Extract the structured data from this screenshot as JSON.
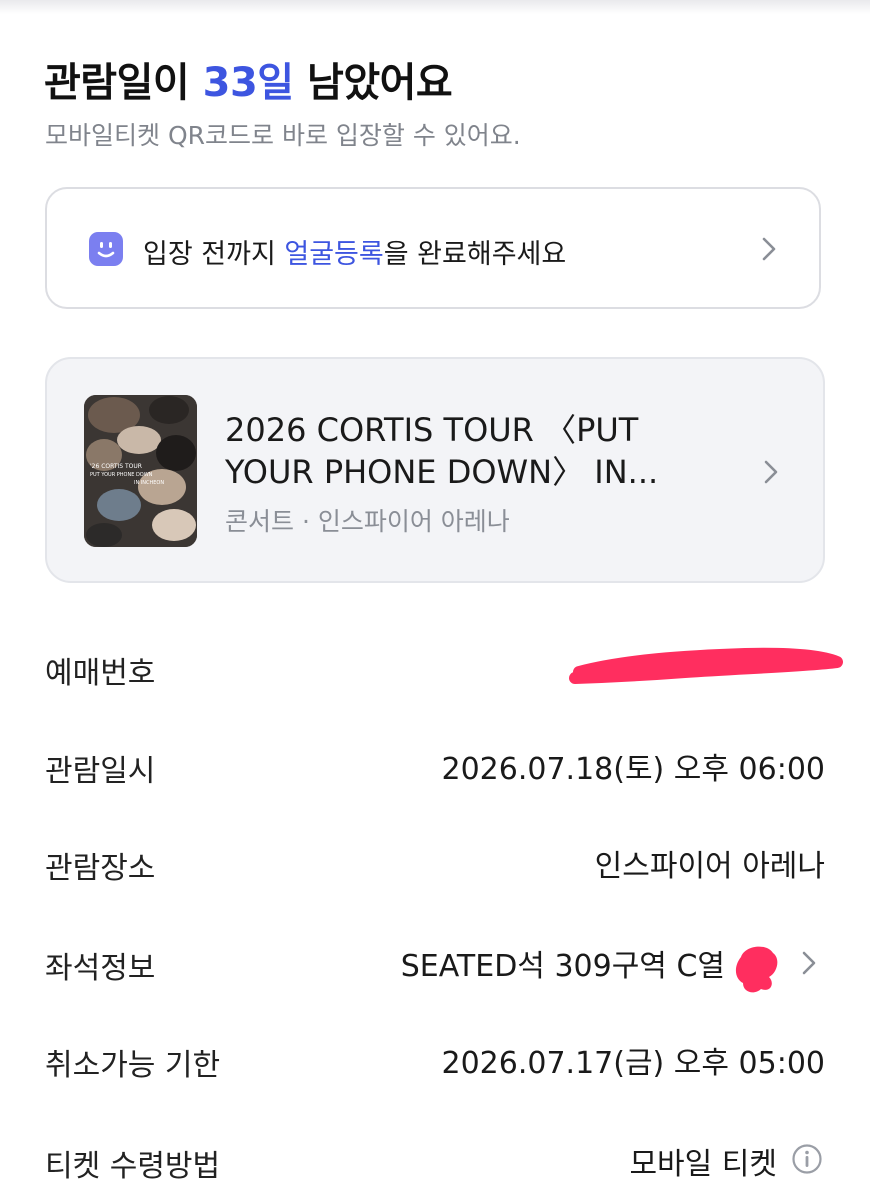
{
  "header": {
    "countdown_prefix": "관람일이 ",
    "countdown_days": "33일",
    "countdown_suffix": " 남았어요",
    "subtitle": "모바일티켓 QR코드로 바로 입장할 수 있어요."
  },
  "face_banner": {
    "text_before": "입장 전까지 ",
    "link_text": "얼굴등록",
    "text_after": "을 완료해주세요",
    "icon": "smile-face-icon"
  },
  "event": {
    "title": "2026 CORTIS TOUR 〈PUT YOUR PHONE DOWN〉 IN...",
    "meta": "콘서트 · 인스파이어 아레나",
    "poster_text": "'26 CORTIS TOUR PUT YOUR PHONE DOWN IN INCHEON"
  },
  "details": {
    "reservation_label": "예매번호",
    "reservation_value": "",
    "date_label": "관람일시",
    "date_value": "2026.07.18(토) 오후 06:00",
    "venue_label": "관람장소",
    "venue_value": "인스파이어 아레나",
    "seat_label": "좌석정보",
    "seat_value": "SEATED석 309구역 C열",
    "cancel_label": "취소가능 기한",
    "cancel_value": "2026.07.17(금) 오후 05:00",
    "delivery_label": "티켓 수령방법",
    "delivery_value": "모바일 티켓"
  },
  "colors": {
    "accent": "#3d55e0",
    "face_icon": "#7b7ff0",
    "redaction": "#ff2e5f",
    "card_bg": "#f3f4f7"
  }
}
